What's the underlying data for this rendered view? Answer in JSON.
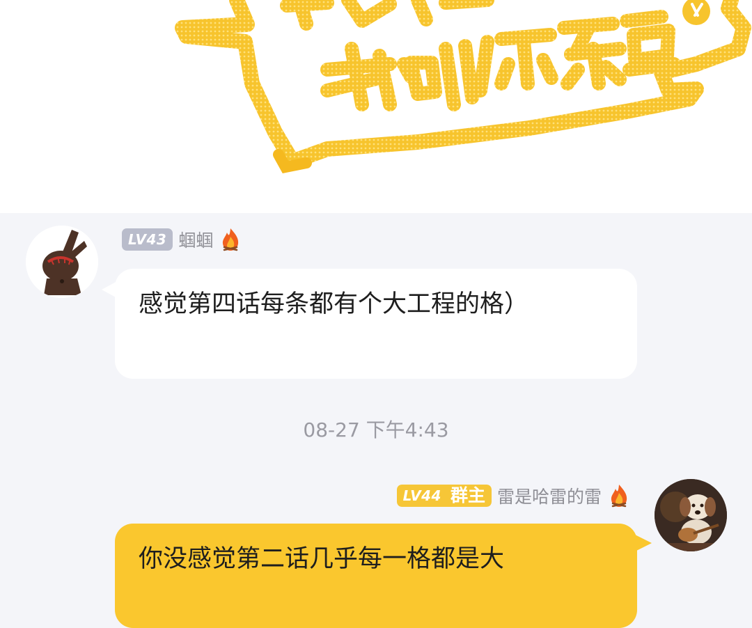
{
  "banner": {
    "art_text": "我叫你杂鱼",
    "logo_description": "yellow comic speech-bubble artwork"
  },
  "messages": [
    {
      "level": "LV43",
      "username": "蝈蝈",
      "text": "感觉第四话每条都有个大工程的格）",
      "avatar_icon": "bunny-avatar-icon"
    },
    {
      "level": "LV44",
      "role": "群主",
      "username": "雷是哈雷的雷",
      "text": "你没感觉第二话几乎每一格都是大",
      "avatar_icon": "dog-guitar-avatar-icon"
    }
  ],
  "timestamp": "08-27 下午4:43",
  "colors": {
    "accent": "#fac72e",
    "background": "#f4f5f9",
    "level_gray": "#b9bccb",
    "level_gold": "#f6c637"
  }
}
